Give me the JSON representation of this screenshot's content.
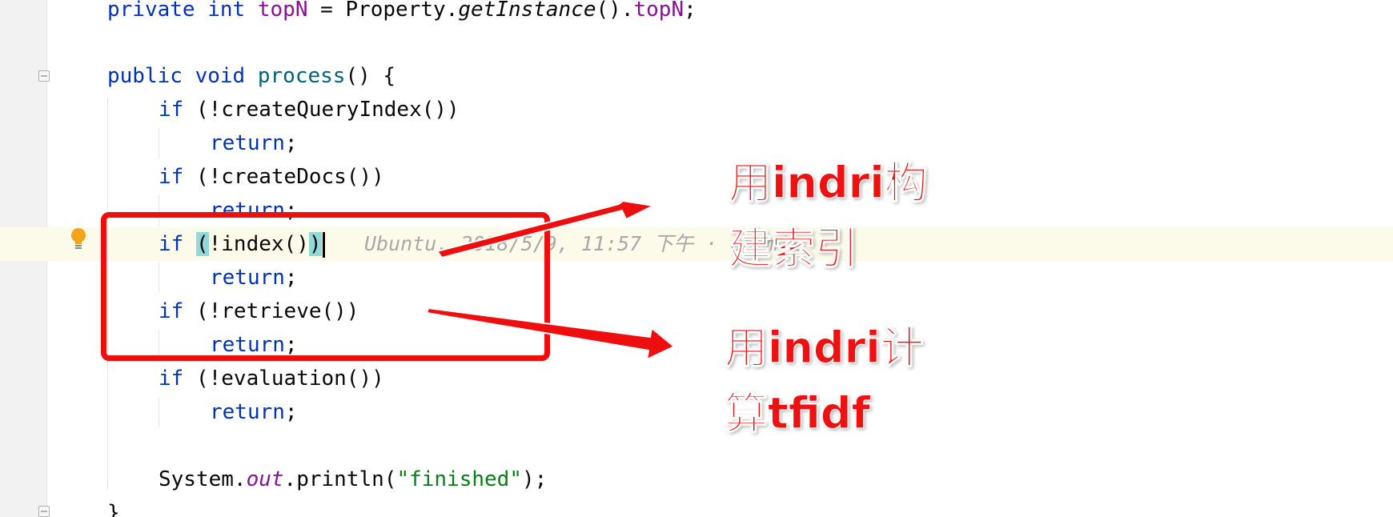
{
  "code": {
    "line1": {
      "kw1": "private",
      "kw2": "int",
      "field": "topN",
      "mid": " = Property.",
      "method": "getInstance",
      "after": "().",
      "field2": "topN",
      "end": ";"
    },
    "line3": {
      "kw1": "public",
      "kw2": "void",
      "method": "process",
      "end": "() {"
    },
    "if_keyword": "if",
    "return_keyword": "return",
    "semicolon": ";",
    "cond_query_index": " (!createQueryIndex())",
    "cond_create_docs": " (!createDocs())",
    "cond_index_open": "(",
    "cond_index_mid": "!index()",
    "cond_index_close": ")",
    "cond_retrieve": " (!retrieve())",
    "cond_evaluation": " (!evaluation())",
    "println": {
      "prefix": "System.",
      "field": "out",
      "mid": ".println(",
      "string": "\"finished\"",
      "end": ");"
    },
    "closing_brace": "}"
  },
  "inline_hint": "Ubuntu, 2018/5/9, 11:57 下午 · commit",
  "annotations": {
    "index_label_line1": "用indri构",
    "index_label_line2": "建索引",
    "tfidf_label_line1": "用indri计",
    "tfidf_label_line2": "算tfidf"
  },
  "colors": {
    "annotation_red": "#ee0e0e",
    "keyword": "#0033b3",
    "field": "#871094",
    "string": "#067d17",
    "current_line_bg": "#fcfae8",
    "bracket_match": "#93d9d9"
  }
}
